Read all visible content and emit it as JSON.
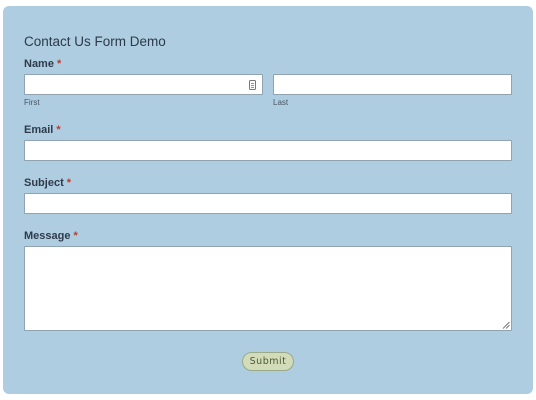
{
  "form": {
    "title": "Contact Us Form Demo",
    "required_marker": "*",
    "name": {
      "label": "Name",
      "first_sublabel": "First",
      "last_sublabel": "Last",
      "first_value": "",
      "last_value": ""
    },
    "email": {
      "label": "Email",
      "value": ""
    },
    "subject": {
      "label": "Subject",
      "value": ""
    },
    "message": {
      "label": "Message",
      "value": ""
    },
    "submit_label": "Submit"
  },
  "colors": {
    "card_background": "#aecde0",
    "required": "#c0392b",
    "submit_background": "#d3dcb8"
  },
  "icons": {
    "autofill": "contact-card-icon",
    "resize": "resize-handle-icon"
  }
}
